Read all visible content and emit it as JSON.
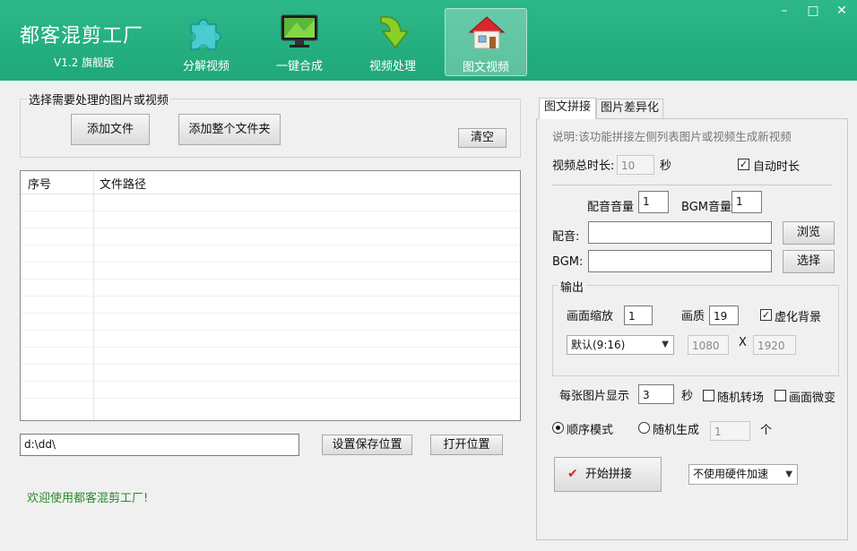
{
  "header": {
    "title": "都客混剪工厂",
    "version": "V1.2 旗舰版",
    "nav": [
      {
        "label": "分解视频",
        "icon": "puzzle-icon"
      },
      {
        "label": "一键合成",
        "icon": "monitor-icon"
      },
      {
        "label": "视频处理",
        "icon": "green-arrow-icon"
      },
      {
        "label": "图文视频",
        "icon": "house-icon"
      }
    ],
    "active_nav": 3,
    "window_controls": {
      "minimize": "–",
      "maximize": "□",
      "close": "✕"
    }
  },
  "left": {
    "group_title": "选择需要处理的图片或视频",
    "add_file": "添加文件",
    "add_folder": "添加整个文件夹",
    "clear": "清空",
    "table": {
      "columns": [
        "序号",
        "文件路径"
      ],
      "rows": []
    },
    "save_path": "d:\\dd\\",
    "set_save_location": "设置保存位置",
    "open_location": "打开位置",
    "status": "欢迎使用都客混剪工厂!"
  },
  "right": {
    "tabs": [
      "图文拼接",
      "图片差异化"
    ],
    "active_tab": 0,
    "description": "说明:该功能拼接左侧列表图片或视频生成新视频",
    "total_duration_label": "视频总时长:",
    "total_duration_value": "10",
    "seconds_unit": "秒",
    "auto_duration_label": "自动时长",
    "auto_duration_checked": true,
    "voice_volume_label": "配音音量",
    "voice_volume_value": "1",
    "bgm_volume_label": "BGM音量",
    "bgm_volume_value": "1",
    "voice_label": "配音:",
    "voice_value": "",
    "browse": "浏览",
    "bgm_label": "BGM:",
    "bgm_value": "",
    "choose": "选择",
    "output": {
      "title": "输出",
      "scale_label": "画面缩放",
      "scale_value": "1",
      "quality_label": "画质",
      "quality_value": "19",
      "blur_bg_label": "虚化背景",
      "blur_bg_checked": true,
      "ratio_selected": "默认(9:16)",
      "width_value": "1080",
      "x_label": "X",
      "height_value": "1920"
    },
    "per_image_label": "每张图片显示",
    "per_image_value": "3",
    "per_image_unit": "秒",
    "random_transition_label": "随机转场",
    "random_transition_checked": false,
    "micro_motion_label": "画面微变",
    "micro_motion_checked": false,
    "sequential_mode_label": "顺序模式",
    "random_generate_label": "随机生成",
    "mode_selected": "sequential",
    "random_count_value": "1",
    "count_unit": "个",
    "start_button": "开始拼接",
    "hw_accel_selected": "不使用硬件加速"
  },
  "colors": {
    "header_green": "#22ab7c",
    "status_green": "#2a8a2a",
    "start_icon_red": "#e02020"
  }
}
